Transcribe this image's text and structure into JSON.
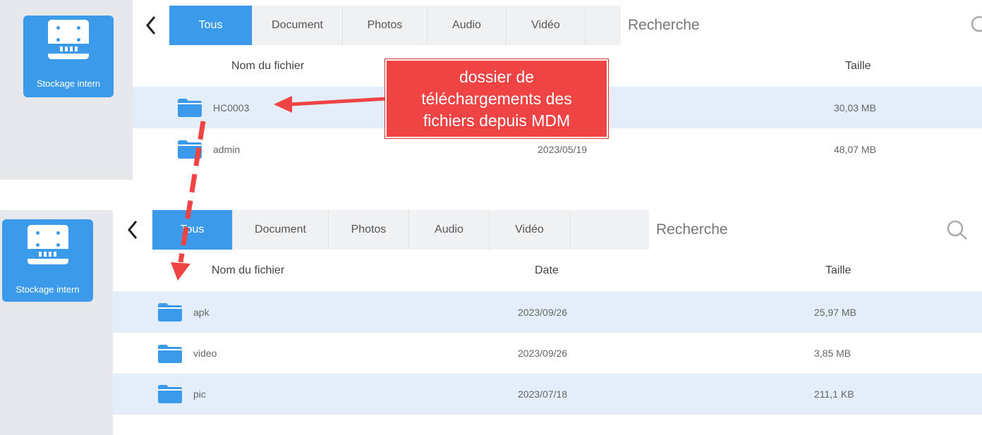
{
  "colors": {
    "accent": "#3b9bea",
    "row_alt": "#e3eef9",
    "callout": "#ef4344"
  },
  "top_screen": {
    "storage_label": "Stockage intern",
    "back_icon": "chevron-left-icon",
    "tabs": [
      {
        "label": "Tous",
        "active": true
      },
      {
        "label": "Document",
        "active": false
      },
      {
        "label": "Photos",
        "active": false
      },
      {
        "label": "Audio",
        "active": false
      },
      {
        "label": "Vidéo",
        "active": false
      }
    ],
    "search_placeholder": "Recherche",
    "columns": {
      "name": "Nom du fichier",
      "size": "Taille"
    },
    "rows": [
      {
        "name": "HC0003",
        "date": "",
        "size": "30,03 MB"
      },
      {
        "name": "admin",
        "date": "2023/05/19",
        "size": "48,07 MB"
      }
    ]
  },
  "bottom_screen": {
    "storage_label": "Stockage intern",
    "back_icon": "chevron-left-icon",
    "tabs": [
      {
        "label": "Tous",
        "active": true
      },
      {
        "label": "Document",
        "active": false
      },
      {
        "label": "Photos",
        "active": false
      },
      {
        "label": "Audio",
        "active": false
      },
      {
        "label": "Vidéo",
        "active": false
      }
    ],
    "search_placeholder": "Recherche",
    "columns": {
      "name": "Nom du fichier",
      "date": "Date",
      "size": "Taille"
    },
    "rows": [
      {
        "name": "apk",
        "date": "2023/09/26",
        "size": "25,97 MB"
      },
      {
        "name": "video",
        "date": "2023/09/26",
        "size": "3,85 MB"
      },
      {
        "name": "pic",
        "date": "2023/07/18",
        "size": "211,1 KB"
      }
    ]
  },
  "callout": {
    "lines": [
      "dossier de",
      "téléchargements des",
      "fichiers depuis MDM"
    ]
  }
}
